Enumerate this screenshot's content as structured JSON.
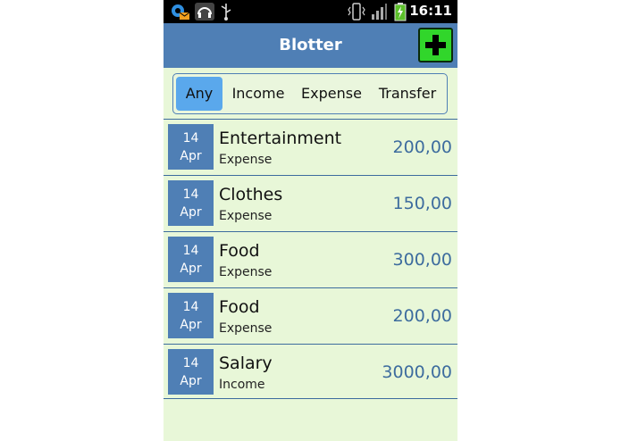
{
  "status_bar": {
    "time": "16:11",
    "icons": [
      "gear-mail-icon",
      "headphones-icon",
      "usb-icon",
      "vibrate-icon",
      "signal-icon",
      "battery-charging-icon"
    ]
  },
  "header": {
    "title": "Blotter",
    "add_icon": "plus-icon"
  },
  "filters": {
    "tabs": [
      {
        "label": "Any",
        "active": true
      },
      {
        "label": "Income",
        "active": false
      },
      {
        "label": "Expense",
        "active": false
      },
      {
        "label": "Transfer",
        "active": false
      }
    ]
  },
  "transactions": [
    {
      "day": "14",
      "month": "Apr",
      "title": "Entertainment",
      "type": "Expense",
      "amount": "200,00"
    },
    {
      "day": "14",
      "month": "Apr",
      "title": "Clothes",
      "type": "Expense",
      "amount": "150,00"
    },
    {
      "day": "14",
      "month": "Apr",
      "title": "Food",
      "type": "Expense",
      "amount": "300,00"
    },
    {
      "day": "14",
      "month": "Apr",
      "title": "Food",
      "type": "Expense",
      "amount": "200,00"
    },
    {
      "day": "14",
      "month": "Apr",
      "title": "Salary",
      "type": "Income",
      "amount": "3000,00"
    }
  ],
  "colors": {
    "header": "#4f7fb5",
    "background": "#e8f7d8",
    "active_tab": "#5aa8ec",
    "add_button": "#31d62b",
    "amount": "#3d6c9e"
  }
}
